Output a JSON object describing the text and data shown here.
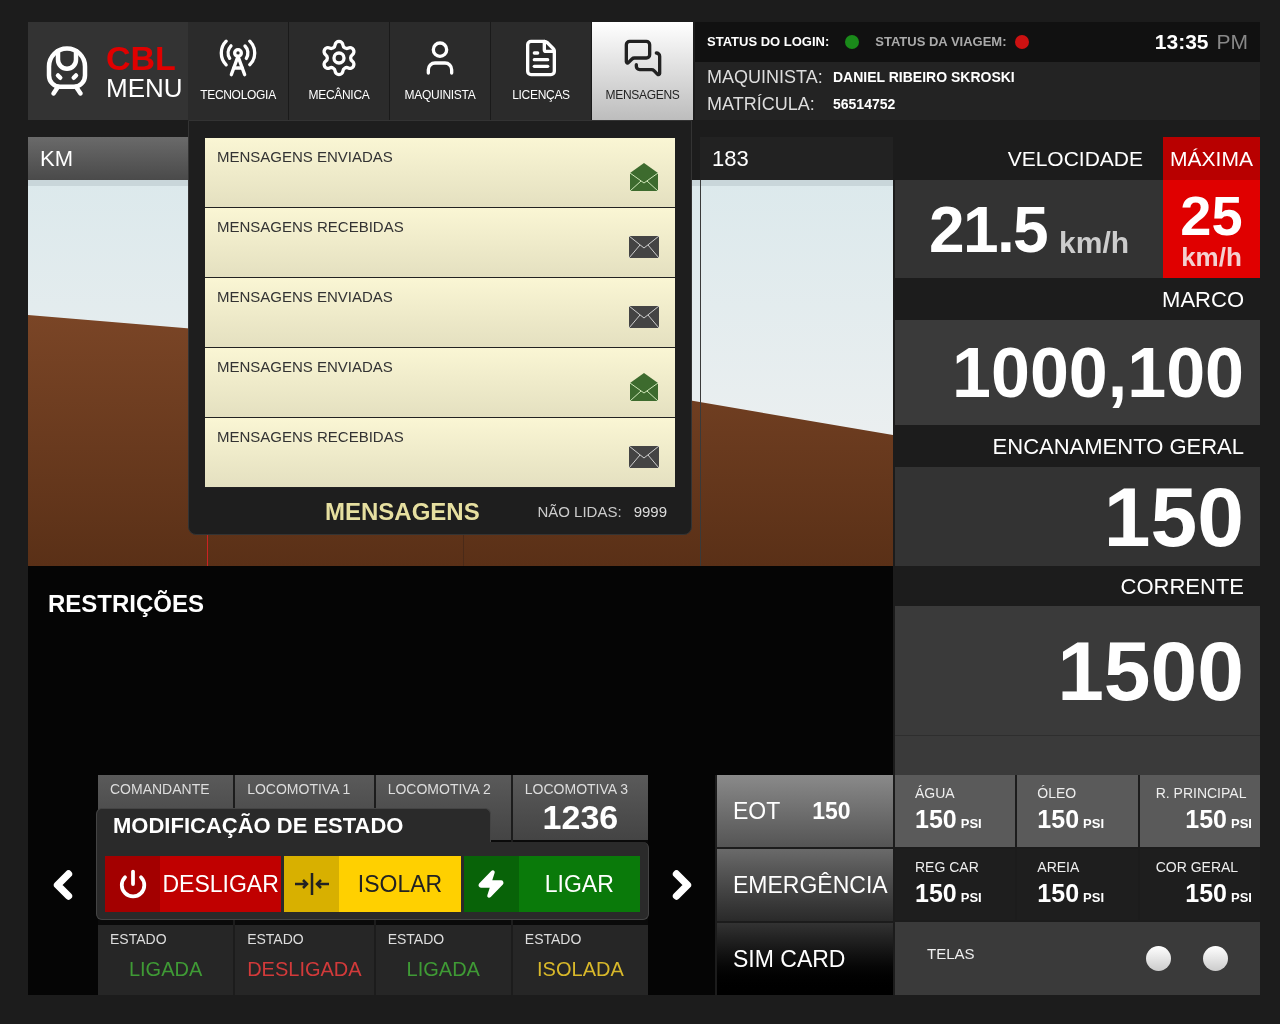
{
  "logo": {
    "brand": "CBL",
    "label": "MENU"
  },
  "nav": [
    {
      "label": "TECNOLOGIA",
      "kind": "antenna",
      "selected": false
    },
    {
      "label": "MECÂNICA",
      "kind": "gear",
      "selected": false
    },
    {
      "label": "MAQUINISTA",
      "kind": "person",
      "selected": false
    },
    {
      "label": "LICENÇAS",
      "kind": "document",
      "selected": false
    },
    {
      "label": "MENSAGENS",
      "kind": "chat",
      "selected": true
    }
  ],
  "status": {
    "login_label": "STATUS DO LOGIN:",
    "login_ok": true,
    "trip_label": "STATUS DA VIAGEM:",
    "trip_ok": false,
    "time": "13:35",
    "period": "PM"
  },
  "driver": {
    "name_label": "MAQUINISTA:",
    "name": "DANIEL RIBEIRO SKROSKI",
    "id_label": "MATRÍCULA:",
    "id": "56514752"
  },
  "km_bar": {
    "label": "KM",
    "value": "183"
  },
  "messages_popup": {
    "items": [
      {
        "label": "MENSAGENS ENVIADAS",
        "opened": true
      },
      {
        "label": "MENSAGENS RECEBIDAS",
        "opened": false
      },
      {
        "label": "MENSAGENS ENVIADAS",
        "opened": false
      },
      {
        "label": "MENSAGENS ENVIADAS",
        "opened": true
      },
      {
        "label": "MENSAGENS RECEBIDAS",
        "opened": false
      }
    ],
    "title": "MENSAGENS",
    "unread_label": "NÃO LIDAS:",
    "unread": "9999"
  },
  "restrictions": {
    "title": "RESTRIÇÕES"
  },
  "speed": {
    "label": "VELOCIDADE",
    "value": "21.5",
    "unit": "km/h",
    "max_label": "MÁXIMA",
    "max_value": "25",
    "max_unit": "km/h"
  },
  "readouts": [
    {
      "label": "MARCO",
      "value": "1000,100"
    },
    {
      "label": "ENCANAMENTO GERAL",
      "value": "150"
    },
    {
      "label": "CORRENTE",
      "value": "1500"
    }
  ],
  "locomotives": [
    {
      "name": "COMANDANTE",
      "state_label": "ESTADO",
      "state": "LIGADA",
      "color": "#3f9a35"
    },
    {
      "name": "LOCOMOTIVA 1",
      "state_label": "ESTADO",
      "state": "DESLIGADA",
      "color": "#d23a3a"
    },
    {
      "name": "LOCOMOTIVA 2",
      "state_label": "ESTADO",
      "state": "LIGADA",
      "color": "#3f9a35"
    },
    {
      "name": "LOCOMOTIVA 3",
      "number": "1236",
      "state_label": "ESTADO",
      "state": "ISOLADA",
      "color": "#d8b82a"
    }
  ],
  "state_popup": {
    "title": "MODIFICAÇÃO DE ESTADO",
    "buttons": [
      {
        "label": "DESLIGAR",
        "kind": "power"
      },
      {
        "label": "ISOLAR",
        "kind": "isolate"
      },
      {
        "label": "LIGAR",
        "kind": "bolt"
      }
    ]
  },
  "side_buttons": [
    {
      "label": "EOT",
      "value": "150"
    },
    {
      "label": "EMERGÊNCIA"
    },
    {
      "label": "SIM CARD"
    }
  ],
  "pressures": [
    {
      "label": "ÁGUA",
      "value": "150",
      "unit": "PSI"
    },
    {
      "label": "ÓLEO",
      "value": "150",
      "unit": "PSI"
    },
    {
      "label": "R. PRINCIPAL",
      "value": "150",
      "unit": "PSI"
    },
    {
      "label": "REG CAR",
      "value": "150",
      "unit": "PSI"
    },
    {
      "label": "AREIA",
      "value": "150",
      "unit": "PSI"
    },
    {
      "label": "COR GERAL",
      "value": "150",
      "unit": "PSI"
    }
  ],
  "screens": {
    "label": "TELAS"
  }
}
